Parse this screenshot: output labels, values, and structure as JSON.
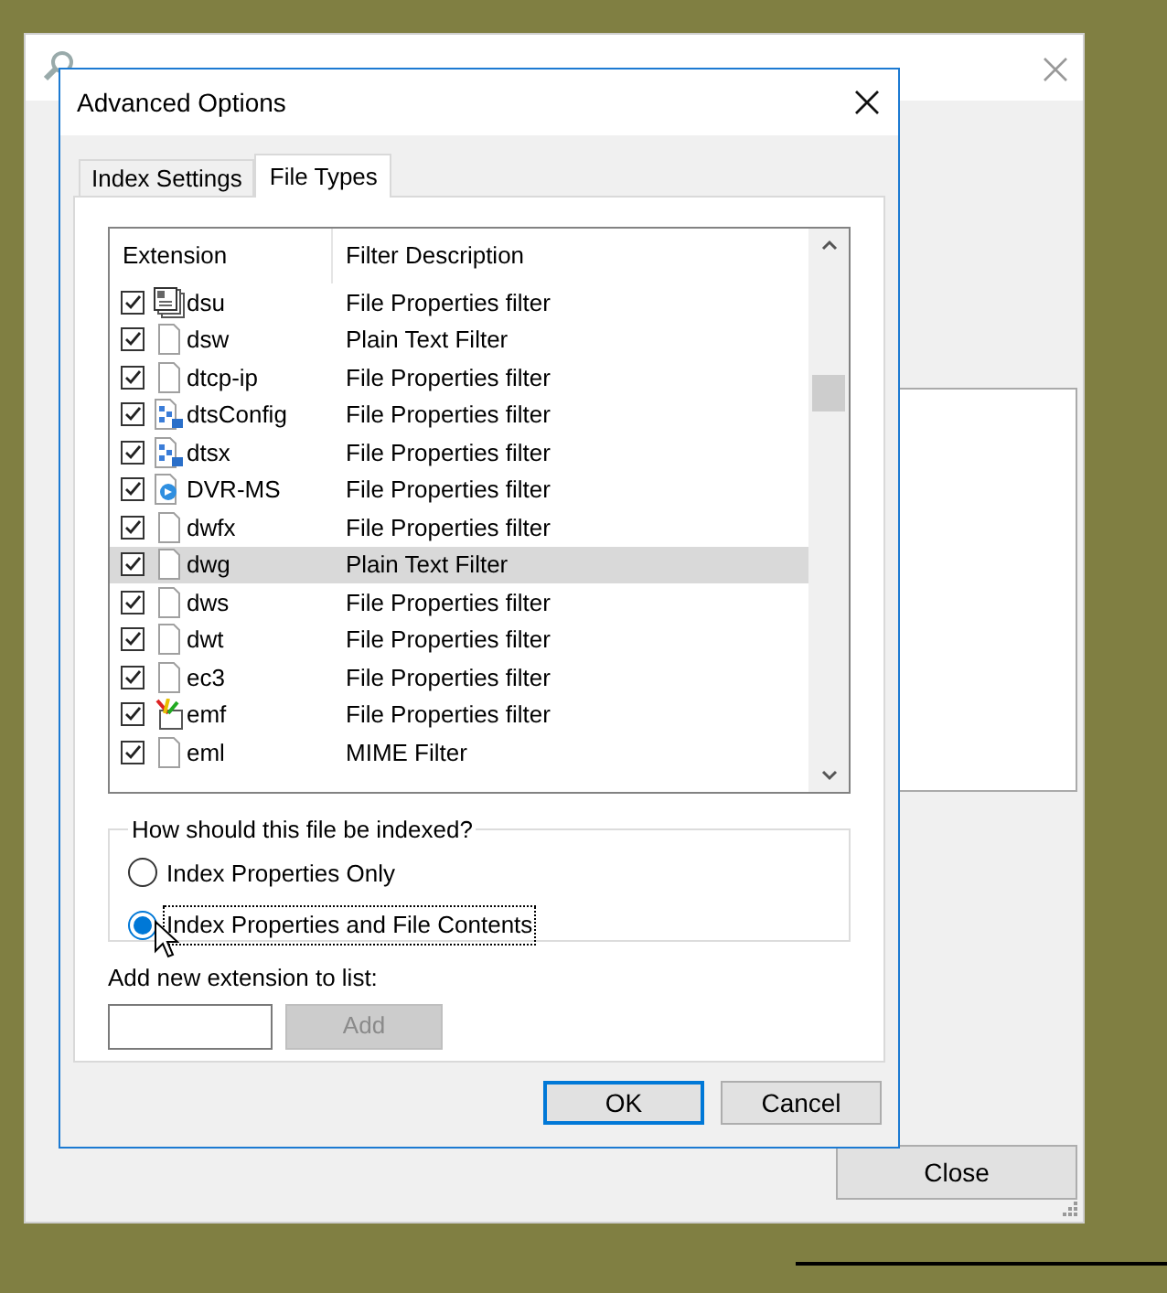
{
  "background_window": {
    "close_button": "Close"
  },
  "dialog": {
    "title": "Advanced Options",
    "tabs": [
      {
        "label": "Index Settings",
        "selected": false
      },
      {
        "label": "File Types",
        "selected": true
      }
    ],
    "table": {
      "columns": [
        "Extension",
        "Filter Description"
      ],
      "rows": [
        {
          "extension": "dsu",
          "filter": "File Properties filter",
          "kind": "stack",
          "checked": true,
          "selected": false
        },
        {
          "extension": "dsw",
          "filter": "Plain Text Filter",
          "kind": "document",
          "checked": true,
          "selected": false
        },
        {
          "extension": "dtcp-ip",
          "filter": "File Properties filter",
          "kind": "document",
          "checked": true,
          "selected": false
        },
        {
          "extension": "dtsConfig",
          "filter": "File Properties filter",
          "kind": "config",
          "checked": true,
          "selected": false
        },
        {
          "extension": "dtsx",
          "filter": "File Properties filter",
          "kind": "config",
          "checked": true,
          "selected": false
        },
        {
          "extension": "DVR-MS",
          "filter": "File Properties filter",
          "kind": "media",
          "checked": true,
          "selected": false
        },
        {
          "extension": "dwfx",
          "filter": "File Properties filter",
          "kind": "document",
          "checked": true,
          "selected": false
        },
        {
          "extension": "dwg",
          "filter": "Plain Text Filter",
          "kind": "document",
          "checked": true,
          "selected": true
        },
        {
          "extension": "dws",
          "filter": "File Properties filter",
          "kind": "document",
          "checked": true,
          "selected": false
        },
        {
          "extension": "dwt",
          "filter": "File Properties filter",
          "kind": "document",
          "checked": true,
          "selected": false
        },
        {
          "extension": "ec3",
          "filter": "File Properties filter",
          "kind": "document",
          "checked": true,
          "selected": false
        },
        {
          "extension": "emf",
          "filter": "File Properties filter",
          "kind": "paint",
          "checked": true,
          "selected": false
        },
        {
          "extension": "eml",
          "filter": "MIME Filter",
          "kind": "document",
          "checked": true,
          "selected": false
        }
      ]
    },
    "index_group": {
      "label": "How should this file be indexed?",
      "options": [
        {
          "label": "Index Properties Only",
          "selected": false
        },
        {
          "label": "Index Properties and File Contents",
          "selected": true
        }
      ]
    },
    "add_extension": {
      "label": "Add new extension to list:",
      "button": "Add",
      "button_disabled": true
    },
    "buttons": [
      "OK",
      "Cancel"
    ]
  }
}
